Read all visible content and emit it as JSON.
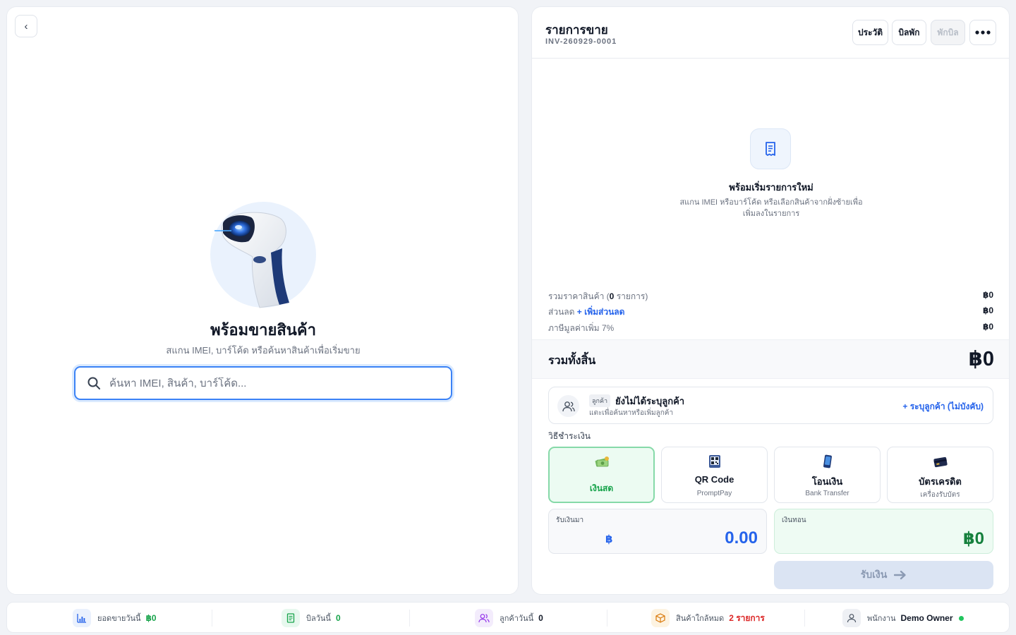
{
  "left": {
    "back_icon": "chevron-left",
    "ready_title": "พร้อมขายสินค้า",
    "ready_subtitle": "สแกน IMEI, บาร์โค้ด หรือค้นหาสินค้าเพื่อเริ่มขาย",
    "search_placeholder": "ค้นหา IMEI, สินค้า, บาร์โค้ด...",
    "search_value": ""
  },
  "sale": {
    "title": "รายการขาย",
    "invoice_no": "INV-260929-0001",
    "buttons": {
      "history": "ประวัติ",
      "held_bills": "บิลพัก",
      "hold_bill": "พักบิล",
      "more_icon": "more-horizontal"
    },
    "empty": {
      "icon": "receipt",
      "title": "พร้อมเริ่มรายการใหม่",
      "subtitle": "สแกน IMEI หรือบาร์โค้ด หรือเลือกสินค้าจากฝั่งซ้ายเพื่อเพิ่มลงในรายการ"
    },
    "summary": {
      "subtotal_prefix": "รวมราคาสินค้า (",
      "subtotal_count": "0",
      "subtotal_suffix": " รายการ)",
      "subtotal_value": "฿0",
      "discount_label": "ส่วนลด",
      "discount_link": "+ เพิ่มส่วนลด",
      "discount_value": "฿0",
      "vat_label": "ภาษีมูลค่าเพิ่ม 7%",
      "vat_value": "฿0"
    },
    "total": {
      "label": "รวมทั้งสิ้น",
      "value": "฿0"
    },
    "customer": {
      "tag": "ลูกค้า",
      "name": "ยังไม่ได้ระบุลูกค้า",
      "hint": "แตะเพื่อค้นหาหรือเพิ่มลูกค้า",
      "link": "+ ระบุลูกค้า (ไม่บังคับ)"
    },
    "payment_label": "วิธีชำระเงิน",
    "payment_methods": [
      {
        "name": "เงินสด",
        "sub": "",
        "icon": "cash-icon",
        "active": true
      },
      {
        "name": "QR Code",
        "sub": "PromptPay",
        "icon": "qr-code-icon",
        "active": false
      },
      {
        "name": "โอนเงิน",
        "sub": "Bank Transfer",
        "icon": "mobile-phone-icon",
        "active": false
      },
      {
        "name": "บัตรเครดิต",
        "sub": "เครื่องรับบัตร",
        "icon": "credit-card-icon",
        "active": false
      }
    ],
    "received": {
      "label": "รับเงินมา",
      "currency": "฿",
      "value": "0.00"
    },
    "change": {
      "label": "เงินทอน",
      "value": "฿0"
    },
    "receive_button": "รับเงิน"
  },
  "status_bar": {
    "sales_today": {
      "label": "ยอดขายวันนี้",
      "value": "฿0",
      "color": "#16a34a"
    },
    "bills_today": {
      "label": "บิลวันนี้",
      "value": "0",
      "color": "#16a34a"
    },
    "customers_today": {
      "label": "ลูกค้าวันนี้",
      "value": "0",
      "color": "#111827"
    },
    "low_stock": {
      "label": "สินค้าใกล้หมด",
      "value": "2 รายการ",
      "color": "#dc2626"
    },
    "staff": {
      "label": "พนักงาน",
      "value": "Demo Owner",
      "status": "online"
    }
  },
  "colors": {
    "accent": "#2563eb",
    "success": "#16a34a",
    "danger": "#dc2626"
  }
}
